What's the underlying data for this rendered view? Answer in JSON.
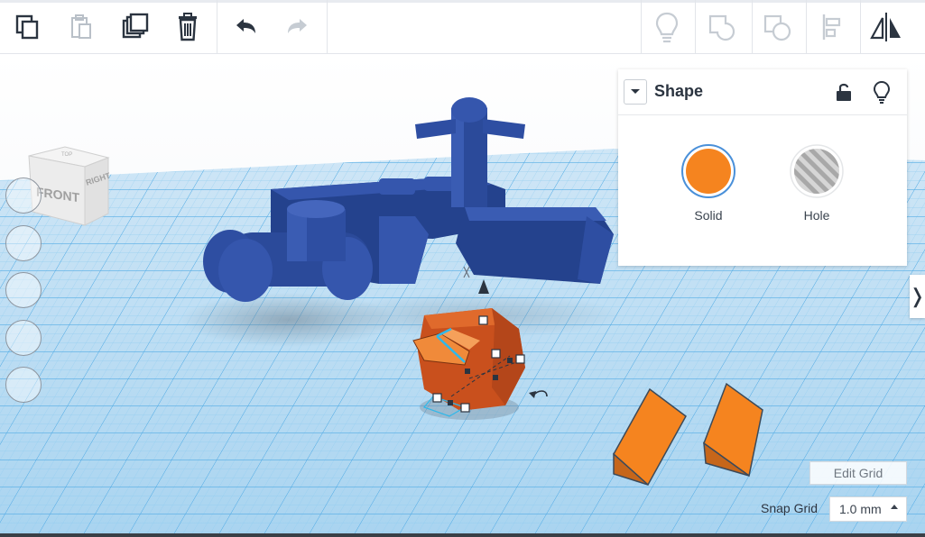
{
  "toolbar": {
    "left_icons": [
      "copy-icon",
      "paste-icon",
      "duplicate-icon",
      "delete-icon",
      "undo-icon",
      "redo-icon"
    ],
    "right_icons": [
      "note-bulb-icon",
      "group-icon",
      "ungroup-icon",
      "align-icon",
      "mirror-icon"
    ]
  },
  "viewcube": {
    "front_label": "FRONT",
    "right_label": "RIGHT",
    "top_label": "TOP"
  },
  "left_controls": [
    "home-view",
    "fit-view",
    "zoom-in",
    "zoom-out",
    "ortho-view"
  ],
  "shape_panel": {
    "title": "Shape",
    "options": [
      {
        "label": "Solid",
        "color": "#f5841f"
      },
      {
        "label": "Hole",
        "color": "#b8b8b8"
      }
    ]
  },
  "grid": {
    "edit_label": "Edit Grid",
    "snap_label": "Snap Grid",
    "snap_value": "1.0 mm"
  },
  "colors": {
    "grid_blue": "#2e9be0",
    "model_blue": "#2b4a9a",
    "shape_orange": "#f5841f",
    "selected_orange": "#d9581f"
  }
}
